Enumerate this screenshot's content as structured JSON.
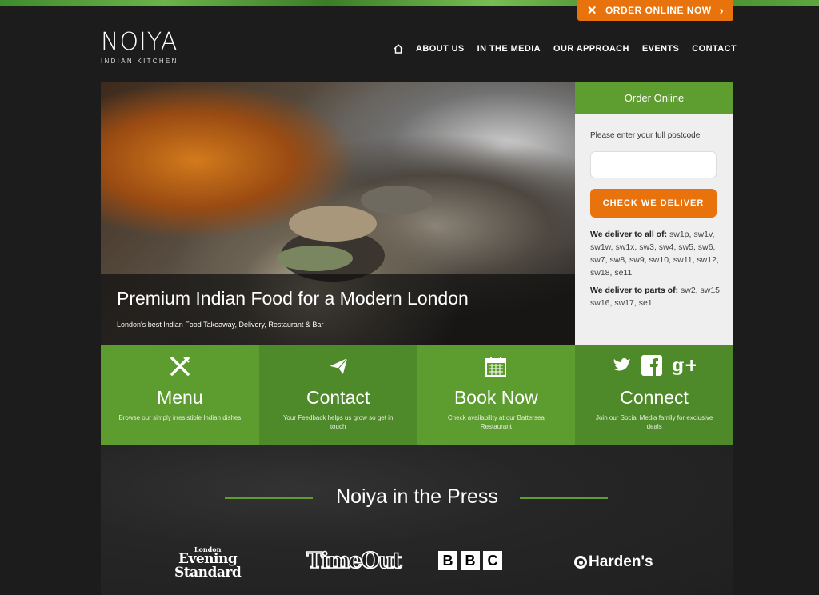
{
  "top_bar": {
    "order_label": "ORDER ONLINE NOW"
  },
  "logo": {
    "name": "NOIYA",
    "tagline": "INDIAN KITCHEN"
  },
  "nav": {
    "items": [
      "ABOUT US",
      "IN THE MEDIA",
      "OUR APPROACH",
      "EVENTS",
      "CONTACT"
    ]
  },
  "hero": {
    "title": "Premium Indian Food for a Modern London",
    "subtitle": "London's best Indian Food Takeaway, Delivery, Restaurant & Bar"
  },
  "order_box": {
    "title": "Order Online",
    "postcode_label": "Please enter your full postcode",
    "postcode_value": "",
    "check_button": "CHECK WE DELIVER",
    "all_label": "We deliver to all of:",
    "all_codes": "sw1p, sw1v, sw1w, sw1x, sw3, sw4, sw5, sw6, sw7, sw8, sw9, sw10, sw11, sw12, sw18, se11",
    "parts_label": "We deliver to parts of:",
    "parts_codes": "sw2, sw15, sw16, sw17, se1"
  },
  "tiles": [
    {
      "title": "Menu",
      "desc": "Browse our simply irresistible Indian dishes"
    },
    {
      "title": "Contact",
      "desc": "Your Feedback helps us grow so get in touch"
    },
    {
      "title": "Book Now",
      "desc": "Check availability at our Battersea Restaurant"
    },
    {
      "title": "Connect",
      "desc": "Join our Social Media family for exclusive deals"
    }
  ],
  "press": {
    "title": "Noiya in the Press",
    "evening_standard": {
      "top": "London",
      "mid": "Evening",
      "bottom": "Standard"
    },
    "timeout": "TimeOut",
    "bbc": [
      "B",
      "B",
      "C"
    ],
    "hardens": "Harden's"
  },
  "colors": {
    "green": "#5e9e31",
    "orange": "#e8720c",
    "background": "#1c1c1c"
  }
}
